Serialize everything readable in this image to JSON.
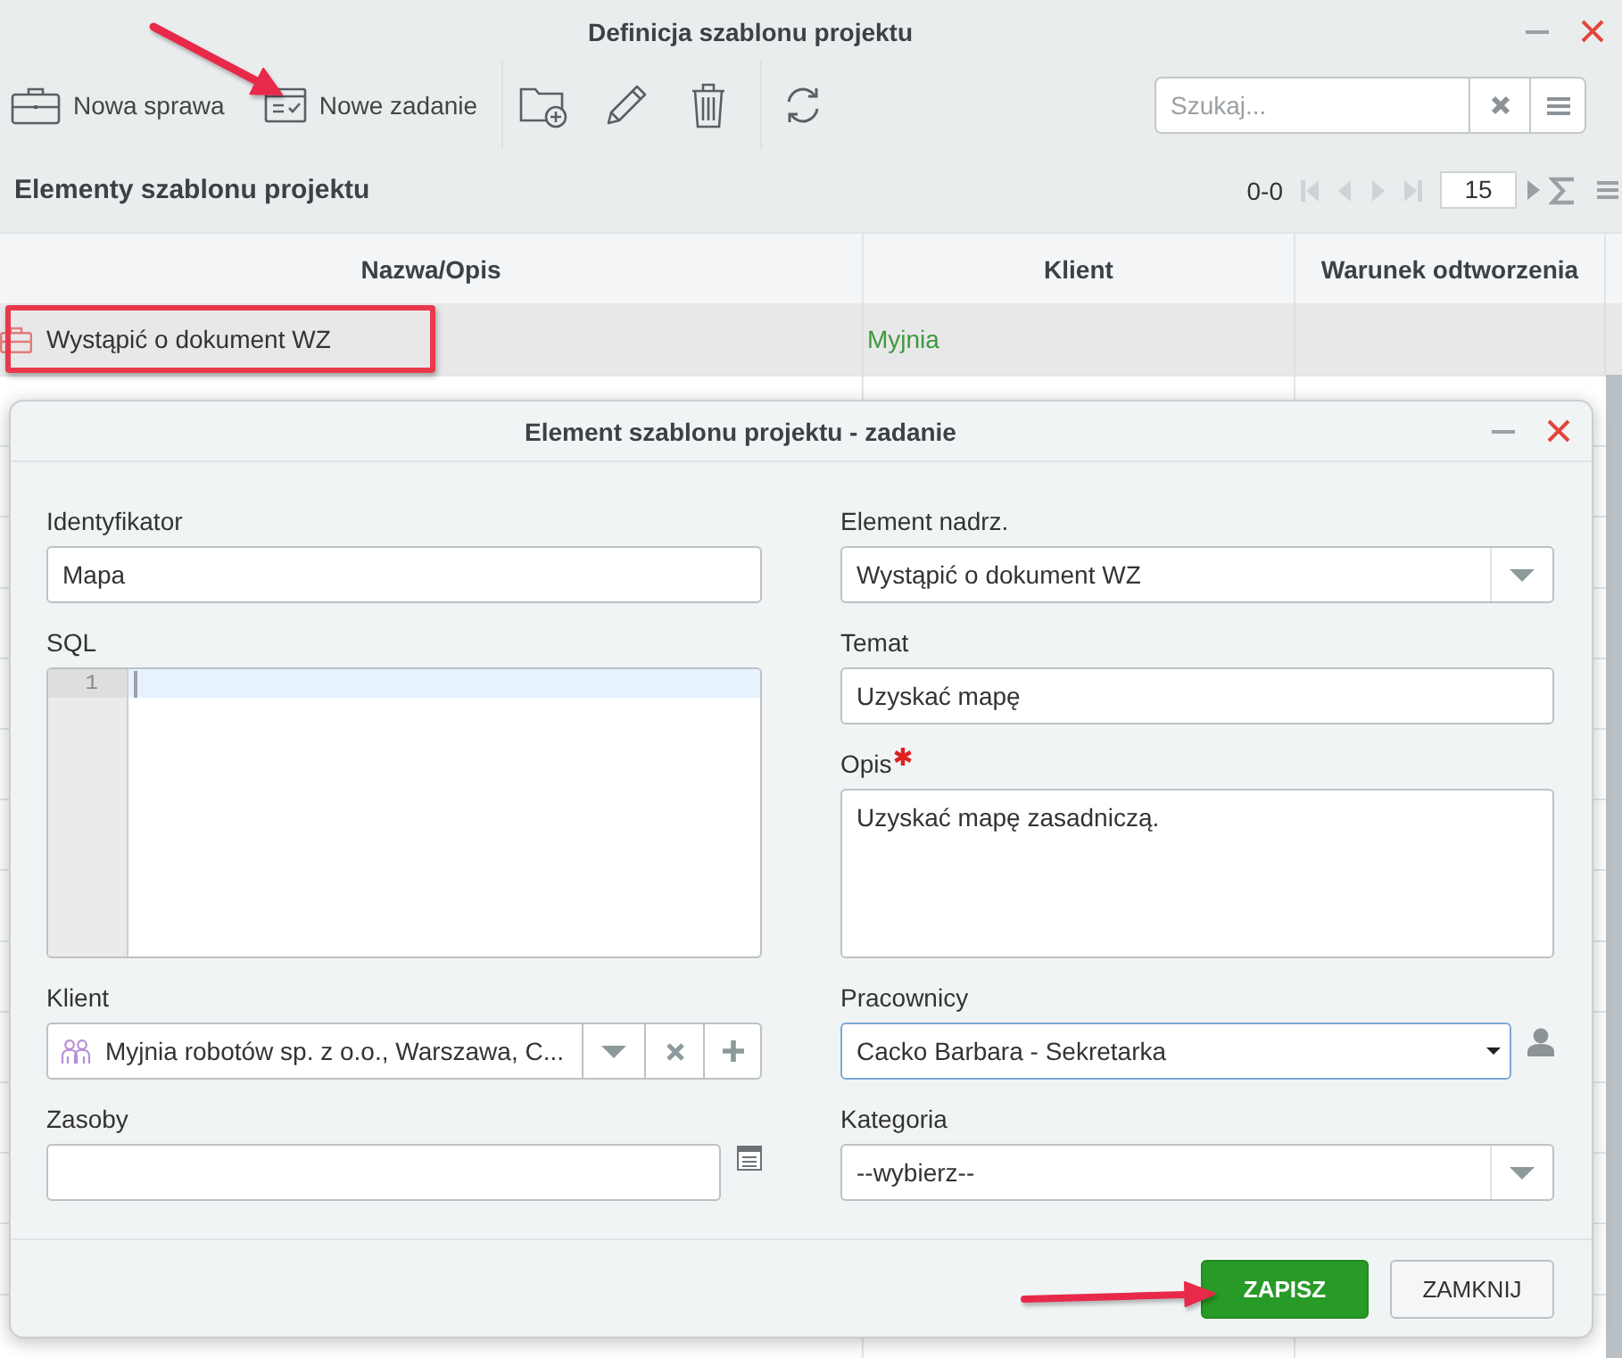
{
  "window": {
    "title": "Definicja szablonu projektu"
  },
  "toolbar": {
    "groups": [
      [
        {
          "kind": "case",
          "label": "Nowa sprawa"
        },
        {
          "kind": "task",
          "label": "Nowe zadanie"
        }
      ],
      [
        {
          "kind": "new-folder"
        },
        {
          "kind": "edit"
        },
        {
          "kind": "delete"
        }
      ],
      [
        {
          "kind": "refresh"
        }
      ]
    ],
    "search": {
      "placeholder": "Szukaj..."
    }
  },
  "section": {
    "title": "Elementy szablonu projektu"
  },
  "pager": {
    "range": "0-0",
    "nav": [
      {
        "kind": "first",
        "disabled": true
      },
      {
        "kind": "prev",
        "disabled": true
      },
      {
        "kind": "next",
        "disabled": true
      },
      {
        "kind": "last",
        "disabled": true
      }
    ],
    "page_size": "15",
    "tools": [
      {
        "kind": "caret"
      },
      {
        "kind": "sum"
      },
      {
        "kind": "menu"
      }
    ]
  },
  "table": {
    "columns": [
      "Nazwa/Opis",
      "Klient",
      "Warunek odtworzenia"
    ],
    "rows": [
      {
        "name": "Wystąpić o dokument WZ",
        "client": "Myjnia",
        "selected": true
      }
    ]
  },
  "dialog": {
    "title": "Element szablonu projektu - zadanie",
    "columns": [
      [
        {
          "kind": "text",
          "label": "Identyfikator",
          "value": "Mapa",
          "focused": false
        },
        {
          "kind": "code",
          "label": "SQL",
          "lines": [
            {
              "number": "1",
              "active": true
            }
          ],
          "focused": false
        },
        {
          "kind": "combo",
          "label": "Klient",
          "value": "Myjnia robotów sp. z o.o., Warszawa, C...",
          "focused": false
        },
        {
          "kind": "picker",
          "label": "Zasoby",
          "focused": false
        }
      ],
      [
        {
          "kind": "select",
          "label": "Element nadrz.",
          "value": "Wystąpić o dokument WZ",
          "focused": false
        },
        {
          "kind": "text",
          "label": "Temat",
          "value": "Uzyskać mapę",
          "focused": false
        },
        {
          "kind": "textarea",
          "label": "Opis",
          "value": "Uzyskać mapę zasadniczą.",
          "required": true,
          "focused": false
        },
        {
          "kind": "native-select",
          "label": "Pracownicy",
          "value": "Cacko Barbara - Sekretarka",
          "focused": true
        },
        {
          "kind": "select",
          "label": "Kategoria",
          "value": "--wybierz--",
          "focused": false
        }
      ]
    ],
    "buttons": [
      {
        "kind": "primary",
        "label": "ZAPISZ"
      },
      {
        "kind": "secondary",
        "label": "ZAMKNIJ"
      }
    ]
  }
}
